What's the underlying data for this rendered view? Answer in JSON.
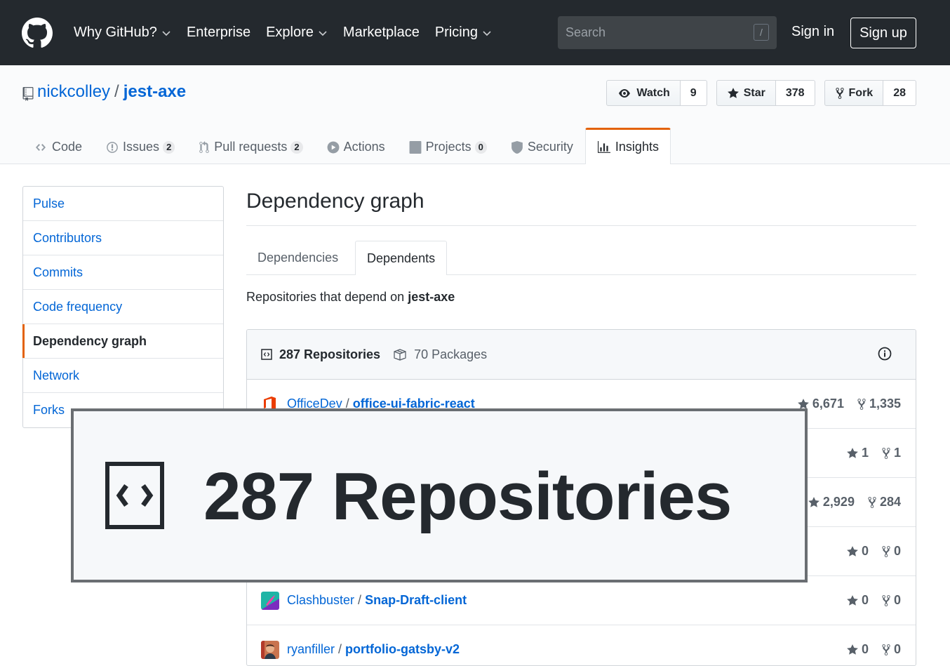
{
  "header": {
    "nav": [
      {
        "label": "Why GitHub?",
        "caret": true
      },
      {
        "label": "Enterprise",
        "caret": false
      },
      {
        "label": "Explore",
        "caret": true
      },
      {
        "label": "Marketplace",
        "caret": false
      },
      {
        "label": "Pricing",
        "caret": true
      }
    ],
    "search_placeholder": "Search",
    "search_key": "/",
    "sign_in": "Sign in",
    "sign_up": "Sign up"
  },
  "repo": {
    "owner": "nickcolley",
    "separator": "/",
    "name": "jest-axe",
    "watch_label": "Watch",
    "watch_count": "9",
    "star_label": "Star",
    "star_count": "378",
    "fork_label": "Fork",
    "fork_count": "28"
  },
  "reponav": [
    {
      "label": "Code",
      "icon": "code-icon",
      "counter": null
    },
    {
      "label": "Issues",
      "icon": "issue-icon",
      "counter": "2"
    },
    {
      "label": "Pull requests",
      "icon": "pull-request-icon",
      "counter": "2"
    },
    {
      "label": "Actions",
      "icon": "play-icon",
      "counter": null
    },
    {
      "label": "Projects",
      "icon": "project-icon",
      "counter": "0"
    },
    {
      "label": "Security",
      "icon": "shield-icon",
      "counter": null
    },
    {
      "label": "Insights",
      "icon": "graph-icon",
      "counter": null,
      "selected": true
    }
  ],
  "sidebar": {
    "items": [
      {
        "label": "Pulse"
      },
      {
        "label": "Contributors"
      },
      {
        "label": "Commits"
      },
      {
        "label": "Code frequency"
      },
      {
        "label": "Dependency graph",
        "selected": true
      },
      {
        "label": "Network"
      },
      {
        "label": "Forks"
      }
    ]
  },
  "main": {
    "title": "Dependency graph",
    "tabs": [
      {
        "label": "Dependencies"
      },
      {
        "label": "Dependents",
        "selected": true
      }
    ],
    "description_prefix": "Repositories that depend on",
    "description_repo": "jest-axe",
    "repositories_label": "287 Repositories",
    "packages_label": "70 Packages"
  },
  "dependents": [
    {
      "owner": "OfficeDev",
      "repo": "office-ui-fabric-react",
      "stars": "6,671",
      "forks": "1,335",
      "avatar_color": "#eb3c00"
    },
    {
      "owner": "",
      "repo": "",
      "stars": "1",
      "forks": "1",
      "avatar_color": "#e1e4e8"
    },
    {
      "owner": "",
      "repo": "",
      "stars": "2,929",
      "forks": "284",
      "avatar_color": "#e1e4e8"
    },
    {
      "owner": "",
      "repo": "",
      "stars": "0",
      "forks": "0",
      "avatar_color": "#e1e4e8"
    },
    {
      "owner": "Clashbuster",
      "repo": "Snap-Draft-client",
      "stars": "0",
      "forks": "0",
      "avatar_color": "#1fb5a6"
    },
    {
      "owner": "ryanfiller",
      "repo": "portfolio-gatsby-v2",
      "stars": "0",
      "forks": "0",
      "avatar_color": "#8a4b3a"
    }
  ],
  "zoom": {
    "text": "287 Repositories"
  },
  "colors": {
    "header_bg": "#24292e",
    "link": "#0366d6",
    "accent": "#e36209",
    "muted": "#586069"
  }
}
